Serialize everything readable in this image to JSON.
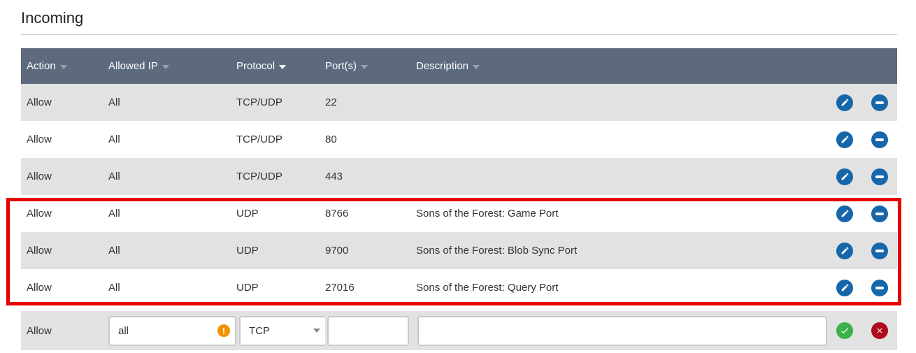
{
  "title": "Incoming",
  "table": {
    "columns": [
      {
        "label": "Action",
        "caret": "muted"
      },
      {
        "label": "Allowed IP",
        "caret": "muted"
      },
      {
        "label": "Protocol",
        "caret": "bright"
      },
      {
        "label": "Port(s)",
        "caret": "muted"
      },
      {
        "label": "Description",
        "caret": "muted"
      }
    ],
    "rows": [
      {
        "action": "Allow",
        "allowed_ip": "All",
        "protocol": "TCP/UDP",
        "ports": "22",
        "description": "",
        "highlighted": false
      },
      {
        "action": "Allow",
        "allowed_ip": "All",
        "protocol": "TCP/UDP",
        "ports": "80",
        "description": "",
        "highlighted": false
      },
      {
        "action": "Allow",
        "allowed_ip": "All",
        "protocol": "TCP/UDP",
        "ports": "443",
        "description": "",
        "highlighted": false
      },
      {
        "action": "Allow",
        "allowed_ip": "All",
        "protocol": "UDP",
        "ports": "8766",
        "description": "Sons of the Forest: Game Port",
        "highlighted": true
      },
      {
        "action": "Allow",
        "allowed_ip": "All",
        "protocol": "UDP",
        "ports": "9700",
        "description": "Sons of the Forest: Blob Sync Port",
        "highlighted": true
      },
      {
        "action": "Allow",
        "allowed_ip": "All",
        "protocol": "UDP",
        "ports": "27016",
        "description": "Sons of the Forest: Query Port",
        "highlighted": true
      }
    ],
    "row_icons": {
      "edit": "pencil-icon",
      "remove": "minus-icon"
    }
  },
  "new_rule": {
    "action_label": "Allow",
    "allowed_ip": {
      "value": "all",
      "warning_icon": "exclamation-icon",
      "warning_glyph": "!"
    },
    "protocol": {
      "selected": "TCP"
    },
    "ports": {
      "value": "",
      "placeholder": ""
    },
    "description": {
      "value": "",
      "placeholder": ""
    },
    "confirm_icon": "check-icon",
    "cancel_icon": "cross-icon"
  },
  "colors": {
    "header_bg": "#5d6a7e",
    "row_alt_bg": "#e2e2e2",
    "caret_muted": "#97a1b0",
    "highlight_border": "#e60000",
    "action_blue": "#1666aa",
    "confirm_green": "#3cb14a",
    "cancel_red": "#af0b1c",
    "warning_orange": "#f39200"
  }
}
